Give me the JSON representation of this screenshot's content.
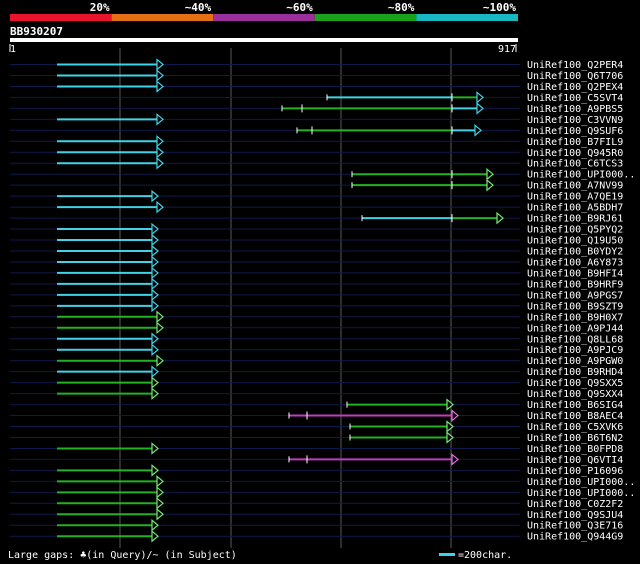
{
  "identity_bar": {
    "labels": [
      "20%",
      "~40%",
      "~60%",
      "~80%",
      "~100%"
    ],
    "colors": [
      "#e8142c",
      "#e56f14",
      "#9b2f9b",
      "#1aa21a",
      "#18b7c4"
    ]
  },
  "query": {
    "id": "BB930207",
    "start": "1",
    "end": "917"
  },
  "palette": {
    "cyan": "#3fd3e8",
    "green": "#22b222",
    "magenta": "#c03cc0",
    "head_green": "#74e874",
    "head_cyan": "#3fd3e8",
    "head_magenta": "#e074e0"
  },
  "hits": [
    {
      "name": "UniRef100_Q2PER4",
      "segs": [
        [
          0,
          100,
          "cyan"
        ]
      ],
      "arrow": "cyan"
    },
    {
      "name": "UniRef100_Q6T706",
      "segs": [
        [
          0,
          100,
          "cyan"
        ]
      ],
      "arrow": "cyan"
    },
    {
      "name": "UniRef100_Q2PEX4",
      "segs": [
        [
          0,
          100,
          "cyan"
        ]
      ],
      "arrow": "cyan"
    },
    {
      "name": "UniRef100_C5SVT4",
      "segs": [
        [
          270,
          395,
          "cyan"
        ],
        [
          395,
          420,
          "green"
        ]
      ],
      "arrow": "cyan",
      "start_tick": true
    },
    {
      "name": "UniRef100_A9PBS5",
      "segs": [
        [
          225,
          245,
          "green"
        ],
        [
          245,
          395,
          "green"
        ],
        [
          395,
          420,
          "cyan"
        ]
      ],
      "arrow": "cyan",
      "start_tick": true
    },
    {
      "name": "UniRef100_C3VVN9",
      "segs": [
        [
          0,
          100,
          "cyan"
        ]
      ],
      "arrow": "cyan"
    },
    {
      "name": "UniRef100_Q9SUF6",
      "segs": [
        [
          240,
          255,
          "green"
        ],
        [
          255,
          395,
          "green"
        ],
        [
          395,
          418,
          "cyan"
        ]
      ],
      "arrow": "cyan",
      "start_tick": true
    },
    {
      "name": "UniRef100_B7FIL9",
      "segs": [
        [
          0,
          100,
          "cyan"
        ]
      ],
      "arrow": "cyan"
    },
    {
      "name": "UniRef100_Q945R0",
      "segs": [
        [
          0,
          100,
          "cyan"
        ]
      ],
      "arrow": "cyan"
    },
    {
      "name": "UniRef100_C6TCS3",
      "segs": [
        [
          0,
          100,
          "cyan"
        ]
      ],
      "arrow": "cyan"
    },
    {
      "name": "UniRef100_UPI000..",
      "segs": [
        [
          295,
          395,
          "green"
        ],
        [
          395,
          430,
          "green"
        ]
      ],
      "arrow": "green",
      "start_tick": true
    },
    {
      "name": "UniRef100_A7NV99",
      "segs": [
        [
          295,
          395,
          "green"
        ],
        [
          395,
          430,
          "green"
        ]
      ],
      "arrow": "green",
      "start_tick": true
    },
    {
      "name": "UniRef100_A7QE19",
      "segs": [
        [
          0,
          95,
          "cyan"
        ]
      ],
      "arrow": "cyan"
    },
    {
      "name": "UniRef100_A5BDH7",
      "segs": [
        [
          0,
          100,
          "cyan"
        ]
      ],
      "arrow": "cyan"
    },
    {
      "name": "UniRef100_B9RJ61",
      "segs": [
        [
          305,
          395,
          "cyan"
        ],
        [
          395,
          440,
          "green"
        ]
      ],
      "arrow": "green",
      "start_tick": true
    },
    {
      "name": "UniRef100_Q5PYQ2",
      "segs": [
        [
          0,
          95,
          "cyan"
        ]
      ],
      "arrow": "cyan"
    },
    {
      "name": "UniRef100_Q19U50",
      "segs": [
        [
          0,
          95,
          "cyan"
        ]
      ],
      "arrow": "cyan"
    },
    {
      "name": "UniRef100_B0YDY2",
      "segs": [
        [
          0,
          95,
          "cyan"
        ]
      ],
      "arrow": "cyan"
    },
    {
      "name": "UniRef100_A6Y873",
      "segs": [
        [
          0,
          95,
          "cyan"
        ]
      ],
      "arrow": "cyan"
    },
    {
      "name": "UniRef100_B9HFI4",
      "segs": [
        [
          0,
          95,
          "cyan"
        ]
      ],
      "arrow": "cyan"
    },
    {
      "name": "UniRef100_B9HRF9",
      "segs": [
        [
          0,
          95,
          "cyan"
        ]
      ],
      "arrow": "cyan"
    },
    {
      "name": "UniRef100_A9PGS7",
      "segs": [
        [
          0,
          95,
          "cyan"
        ]
      ],
      "arrow": "cyan"
    },
    {
      "name": "UniRef100_B9SZT9",
      "segs": [
        [
          0,
          95,
          "cyan"
        ]
      ],
      "arrow": "cyan"
    },
    {
      "name": "UniRef100_B9H0X7",
      "segs": [
        [
          0,
          100,
          "green"
        ]
      ],
      "arrow": "green"
    },
    {
      "name": "UniRef100_A9PJ44",
      "segs": [
        [
          0,
          100,
          "green"
        ]
      ],
      "arrow": "green"
    },
    {
      "name": "UniRef100_Q8LL68",
      "segs": [
        [
          0,
          95,
          "cyan"
        ]
      ],
      "arrow": "cyan"
    },
    {
      "name": "UniRef100_A9PJC9",
      "segs": [
        [
          0,
          95,
          "cyan"
        ]
      ],
      "arrow": "cyan"
    },
    {
      "name": "UniRef100_A9PGW0",
      "segs": [
        [
          0,
          100,
          "green"
        ]
      ],
      "arrow": "green"
    },
    {
      "name": "UniRef100_B9RHD4",
      "segs": [
        [
          0,
          95,
          "cyan"
        ]
      ],
      "arrow": "cyan"
    },
    {
      "name": "UniRef100_Q9SXX5",
      "segs": [
        [
          0,
          95,
          "green"
        ]
      ],
      "arrow": "green"
    },
    {
      "name": "UniRef100_Q9SXX4",
      "segs": [
        [
          0,
          95,
          "green"
        ]
      ],
      "arrow": "green"
    },
    {
      "name": "UniRef100_B6SIG4",
      "segs": [
        [
          290,
          390,
          "green"
        ]
      ],
      "arrow": "green",
      "start_tick": true
    },
    {
      "name": "UniRef100_B8AEC4",
      "segs": [
        [
          232,
          250,
          "magenta"
        ],
        [
          250,
          395,
          "magenta"
        ]
      ],
      "arrow": "magenta",
      "start_tick": true
    },
    {
      "name": "UniRef100_C5XVK6",
      "segs": [
        [
          293,
          390,
          "green"
        ]
      ],
      "arrow": "green",
      "start_tick": true
    },
    {
      "name": "UniRef100_B6T6N2",
      "segs": [
        [
          293,
          390,
          "green"
        ]
      ],
      "arrow": "green",
      "start_tick": true
    },
    {
      "name": "UniRef100_B0FPD8",
      "segs": [
        [
          0,
          95,
          "green"
        ]
      ],
      "arrow": "green"
    },
    {
      "name": "UniRef100_Q6VTI4",
      "segs": [
        [
          232,
          250,
          "magenta"
        ],
        [
          250,
          395,
          "magenta"
        ]
      ],
      "arrow": "magenta",
      "start_tick": true
    },
    {
      "name": "UniRef100_P16096",
      "segs": [
        [
          0,
          95,
          "green"
        ]
      ],
      "arrow": "green"
    },
    {
      "name": "UniRef100_UPI000..",
      "segs": [
        [
          0,
          100,
          "green"
        ]
      ],
      "arrow": "green"
    },
    {
      "name": "UniRef100_UPI000..",
      "segs": [
        [
          0,
          100,
          "green"
        ]
      ],
      "arrow": "green"
    },
    {
      "name": "UniRef100_C0Z2F2",
      "segs": [
        [
          0,
          100,
          "green"
        ]
      ],
      "arrow": "green"
    },
    {
      "name": "UniRef100_Q9SJU4",
      "segs": [
        [
          0,
          100,
          "green"
        ]
      ],
      "arrow": "green"
    },
    {
      "name": "UniRef100_Q3E716",
      "segs": [
        [
          0,
          95,
          "green"
        ]
      ],
      "arrow": "green"
    },
    {
      "name": "UniRef100_Q944G9",
      "segs": [
        [
          0,
          95,
          "green"
        ]
      ],
      "arrow": "green"
    }
  ],
  "footer": {
    "gaps_text": "Large gaps: ♣(in Query)/~ (in Subject)",
    "scale_text": "=200char."
  }
}
